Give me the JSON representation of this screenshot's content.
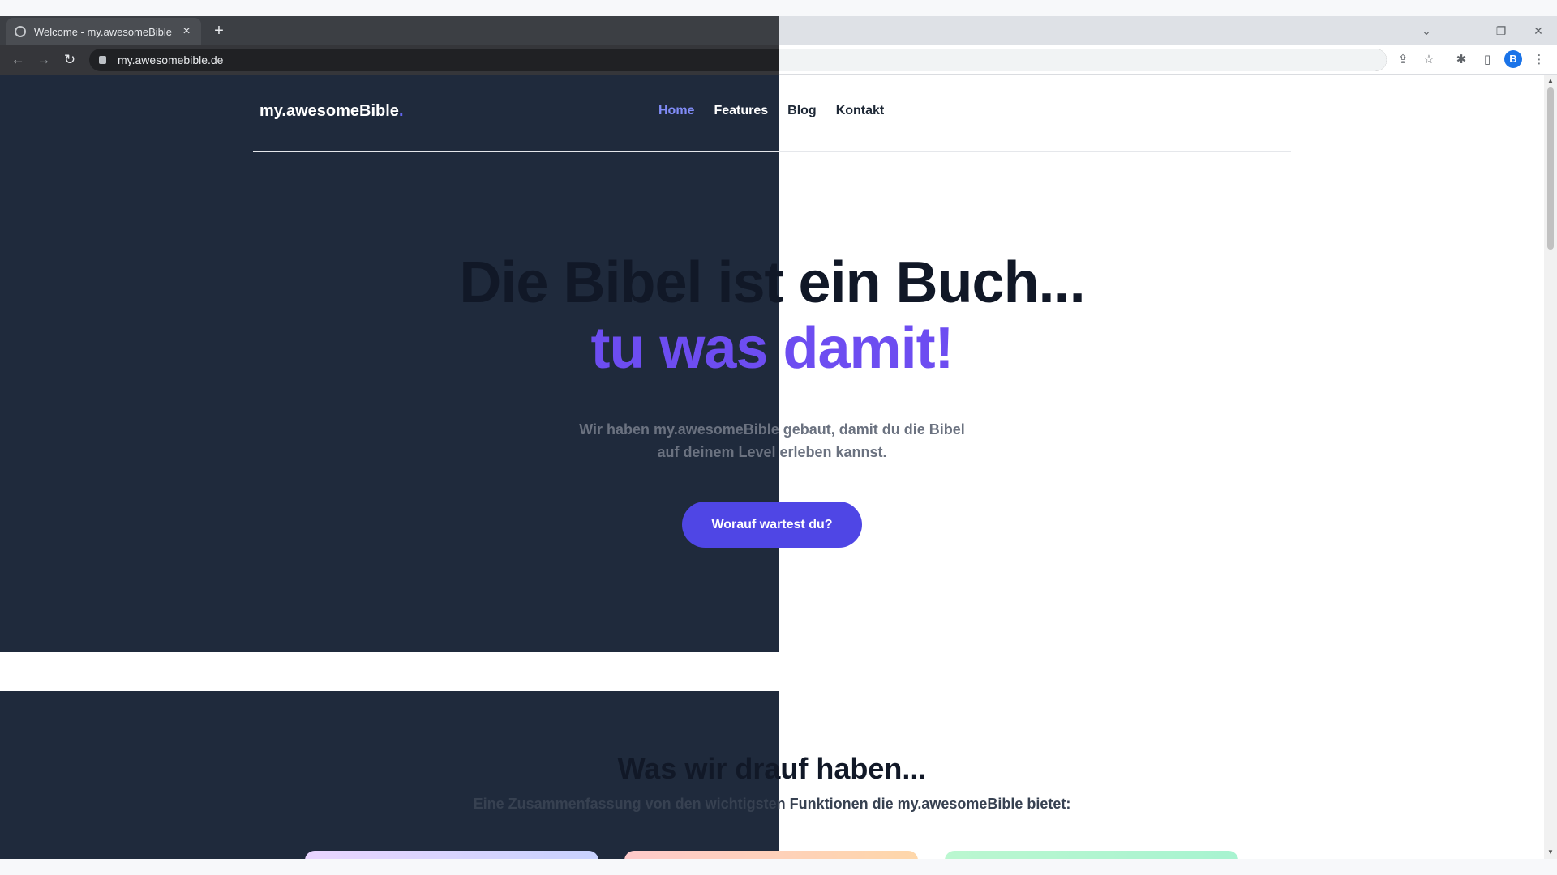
{
  "browser": {
    "tab_title": "Welcome - my.awesomeBible",
    "tab_close": "×",
    "new_tab": "+",
    "url": "my.awesomebible.de",
    "profile_initial": "B",
    "win_minimize": "—",
    "win_restore": "❐",
    "win_close": "✕",
    "tab_search": "⌄",
    "back": "←",
    "forward": "→",
    "reload": "↻",
    "share_icon": "⇪",
    "star_icon": "☆",
    "extensions_icon": "✱",
    "sidepanel_icon": "▯",
    "menu_icon": "⋮"
  },
  "site": {
    "logo_text": "my.awesomeBible",
    "logo_dot": ".",
    "nav": {
      "home": "Home",
      "features": "Features",
      "blog": "Blog",
      "kontakt": "Kontakt"
    },
    "colors": {
      "accent": "#6366f1",
      "cta": "#4f46e5",
      "dark_bg": "#1f2a3c"
    }
  },
  "hero": {
    "headline": "Die Bibel ist ein Buch...",
    "tagline": "tu was damit!",
    "description_line1": "Wir haben my.awesomeBible gebaut, damit du die Bibel",
    "description_line2": "auf deinem Level erleben kannst.",
    "cta_label": "Worauf wartest du?"
  },
  "features": {
    "title": "Was wir drauf haben...",
    "subtitle": "Eine Zusammenfassung von den wichtigsten Funktionen die my.awesomeBible bietet:"
  }
}
